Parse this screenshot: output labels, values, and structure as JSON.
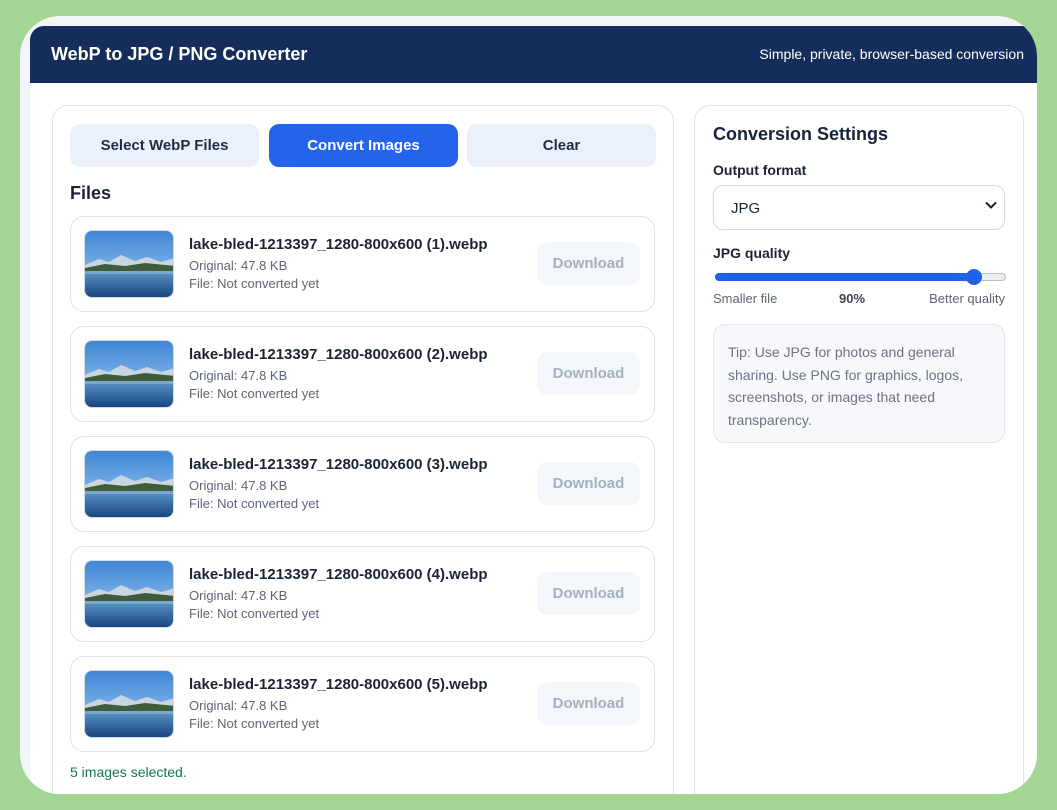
{
  "header": {
    "title": "WebP to JPG / PNG Converter",
    "tagline": "Simple, private, browser-based conversion"
  },
  "toolbar": {
    "select_label": "Select WebP Files",
    "convert_label": "Convert Images",
    "clear_label": "Clear"
  },
  "files_heading": "Files",
  "files": [
    {
      "name": "lake-bled-1213397_1280-800x600 (1).webp",
      "original": "Original: 47.8 KB",
      "status": "File: Not converted yet",
      "download_label": "Download"
    },
    {
      "name": "lake-bled-1213397_1280-800x600 (2).webp",
      "original": "Original: 47.8 KB",
      "status": "File: Not converted yet",
      "download_label": "Download"
    },
    {
      "name": "lake-bled-1213397_1280-800x600 (3).webp",
      "original": "Original: 47.8 KB",
      "status": "File: Not converted yet",
      "download_label": "Download"
    },
    {
      "name": "lake-bled-1213397_1280-800x600 (4).webp",
      "original": "Original: 47.8 KB",
      "status": "File: Not converted yet",
      "download_label": "Download"
    },
    {
      "name": "lake-bled-1213397_1280-800x600 (5).webp",
      "original": "Original: 47.8 KB",
      "status": "File: Not converted yet",
      "download_label": "Download"
    }
  ],
  "selected_count": "5 images selected.",
  "settings": {
    "title": "Conversion Settings",
    "output_format_label": "Output format",
    "output_format_value": "JPG",
    "quality_label": "JPG quality",
    "quality_value": 90,
    "quality_display": "90%",
    "scale_min_label": "Smaller file",
    "scale_max_label": "Better quality",
    "tip": "Tip: Use JPG for photos and general sharing. Use PNG for graphics, logos, screenshots, or images that need transparency."
  },
  "colors": {
    "header_bg": "#142d5a",
    "primary": "#2563eb",
    "success_text": "#137a4e",
    "page_bg": "#a3d695"
  },
  "icons": {
    "thumbnail": "lake-landscape-thumbnail",
    "select_chevron": "chevron-down-icon"
  }
}
